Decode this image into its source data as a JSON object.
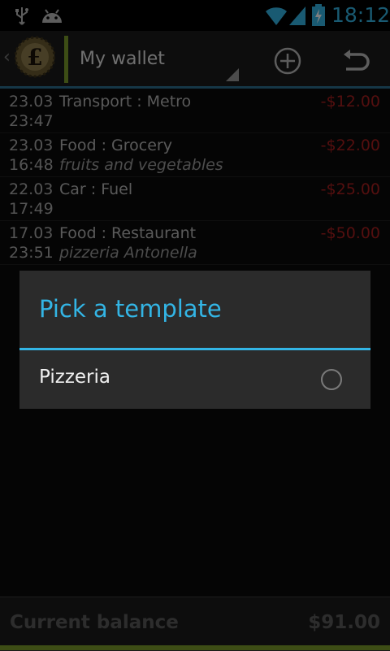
{
  "status_bar": {
    "time": "18:12",
    "icons": [
      "usb-icon",
      "android-icon",
      "wifi-icon",
      "signal-icon",
      "battery-charging-icon"
    ]
  },
  "action_bar": {
    "title": "My wallet",
    "icons": [
      "back-chevron-icon",
      "pound-coin-logo",
      "add-icon",
      "undo-icon"
    ],
    "accent_color": "#7a9a2a"
  },
  "transactions": [
    {
      "date": "23.03",
      "time": "23:47",
      "category": "Transport : Metro",
      "note": "",
      "amount": "-$12.00"
    },
    {
      "date": "23.03",
      "time": "16:48",
      "category": "Food : Grocery",
      "note": "fruits and vegetables",
      "amount": "-$22.00"
    },
    {
      "date": "22.03",
      "time": "17:49",
      "category": "Car : Fuel",
      "note": "",
      "amount": "-$25.00"
    },
    {
      "date": "17.03",
      "time": "23:51",
      "category": "Food : Restaurant",
      "note": "pizzeria Antonella",
      "amount": "-$50.00"
    }
  ],
  "dialog": {
    "title": "Pick a template",
    "items": [
      {
        "label": "Pizzeria",
        "selected": false
      }
    ],
    "accent_color": "#33b5e5"
  },
  "footer": {
    "label": "Current balance",
    "value": "$91.00"
  }
}
